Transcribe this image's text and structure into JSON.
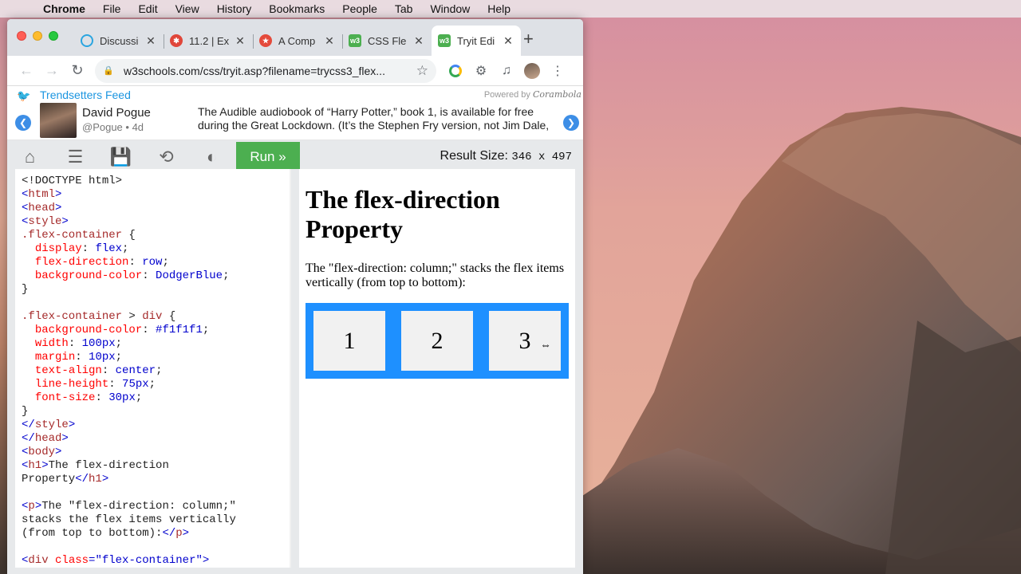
{
  "menubar": {
    "app": "Chrome",
    "items": [
      "File",
      "Edit",
      "View",
      "History",
      "Bookmarks",
      "People",
      "Tab",
      "Window",
      "Help"
    ]
  },
  "browser": {
    "tabs": [
      {
        "title": "Discussi",
        "icon": "discussion-icon",
        "color": "#2aa5e0"
      },
      {
        "title": "11.2 | Ex",
        "icon": "asterisk-icon",
        "color": "#e0463a"
      },
      {
        "title": "A Comp",
        "icon": "star-logo-icon",
        "color": "#e44a3b"
      },
      {
        "title": "CSS Fle",
        "icon": "w3schools-icon",
        "color": "#4caf50"
      },
      {
        "title": "Tryit Edi",
        "icon": "w3schools-icon",
        "color": "#4caf50",
        "active": true
      }
    ],
    "url": "w3schools.com/css/tryit.asp?filename=trycss3_flex..."
  },
  "ticker": {
    "feed_name": "Trendsetters Feed",
    "powered_by": "Powered by",
    "brand": "Corambola",
    "author_name": "David Pogue",
    "author_handle": "@Pogue • 4d",
    "message": "The Audible audiobook of “Harry Potter,” book 1, is available for free during the Great Lockdown. (It’s the Stephen Fry version, not Jim Dale, ..."
  },
  "w3bar": {
    "run_label": "Run »",
    "result_size_label": "Result Size:",
    "result_size_value": "346 x 497"
  },
  "result": {
    "heading": "The flex-direction Property",
    "paragraph": "The \"flex-direction: column;\" stacks the flex items vertically (from top to bottom):",
    "items": [
      "1",
      "2",
      "3"
    ]
  },
  "colors": {
    "run_green": "#4caf50",
    "flex_blue": "#1e90ff",
    "item_gray": "#f1f1f1"
  }
}
